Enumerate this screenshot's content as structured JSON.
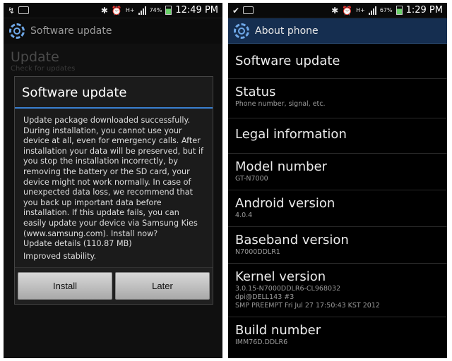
{
  "left": {
    "status": {
      "time": "12:49 PM",
      "battery": "74%",
      "network": "H+"
    },
    "title": "Software update",
    "background": {
      "heading": "Update",
      "sub": "Check for updates"
    },
    "dialog": {
      "title": "Software update",
      "body": "Update package downloaded successfully. During installation, you cannot use your device at all, even for emergency calls. After installation your data will be preserved, but if you stop the installation incorrectly, by removing the battery or the SD card, your device might not work normally. In case of unexpected data loss, we recommend that you back up important data before installation. If this update fails, you can easily update your device via Samsung Kies (www.samsung.com). Install now?",
      "details": "Update details (110.87 MB)",
      "notes": "Improved stability.",
      "install_label": "Install",
      "later_label": "Later"
    }
  },
  "right": {
    "status": {
      "time": "1:29 PM",
      "battery": "67%",
      "network": "H+"
    },
    "title": "About phone",
    "items": [
      {
        "title": "Software update",
        "sub": ""
      },
      {
        "title": "Status",
        "sub": "Phone number, signal, etc."
      },
      {
        "title": "Legal information",
        "sub": ""
      },
      {
        "title": "Model number",
        "sub": "GT-N7000"
      },
      {
        "title": "Android version",
        "sub": "4.0.4"
      },
      {
        "title": "Baseband version",
        "sub": "N7000DDLR1"
      },
      {
        "title": "Kernel version",
        "sub1": "3.0.15-N7000DDLR6-CL968032",
        "sub2": "dpi@DELL143 #3",
        "sub3": "SMP PREEMPT Fri Jul 27 17:50:43 KST 2012"
      },
      {
        "title": "Build number",
        "sub": "IMM76D.DDLR6"
      }
    ]
  },
  "colors": {
    "accent": "#3a80d0",
    "header_right": "#152e50",
    "gear": "#6fa8e8"
  }
}
